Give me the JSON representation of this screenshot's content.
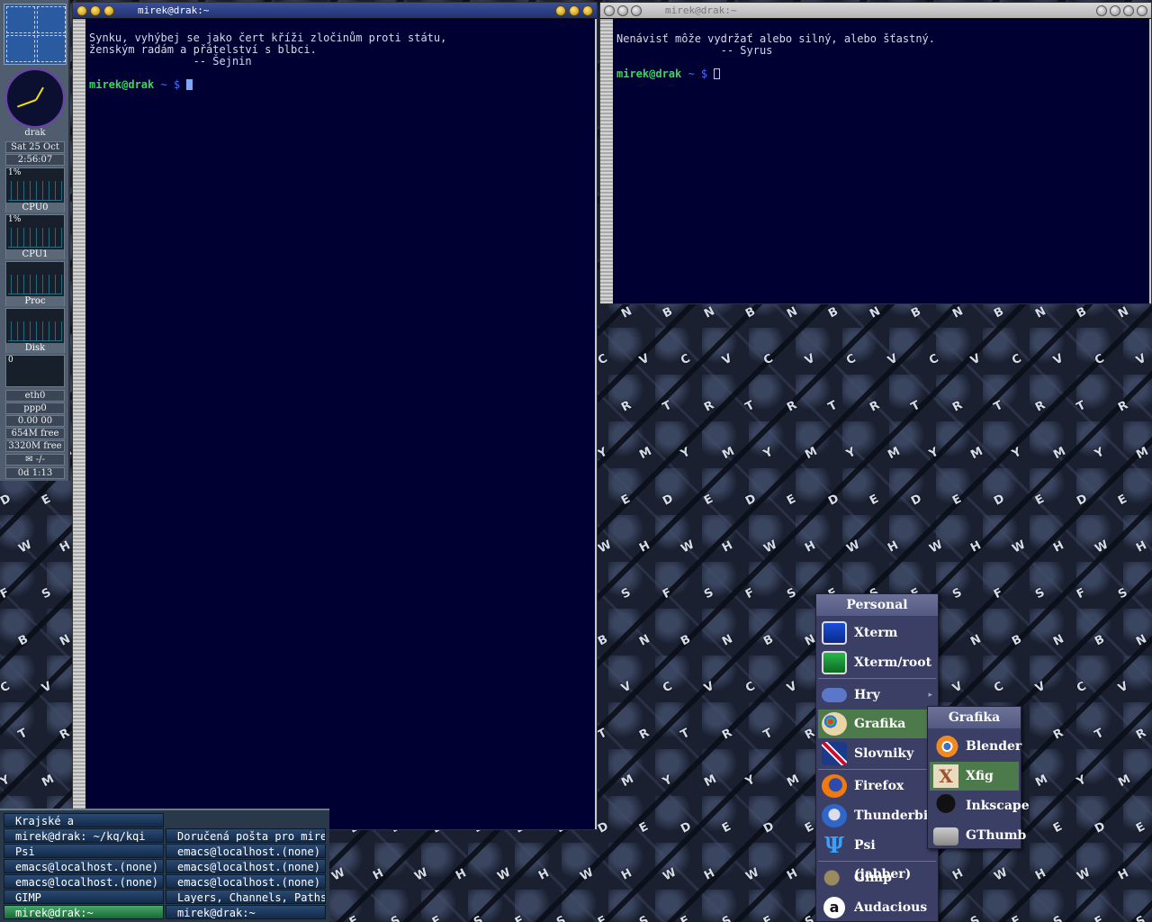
{
  "dock": {
    "host": "drak",
    "date": "Sat 25 Oct",
    "time": "2:56:07",
    "cpu0": {
      "pct": "1%",
      "label": "CPU0"
    },
    "cpu1": {
      "pct": "1%",
      "label": "CPU1"
    },
    "proc": {
      "label": "Proc"
    },
    "disk": {
      "pct": "0",
      "label": "Disk"
    },
    "net": [
      "eth0",
      "ppp0"
    ],
    "net_rate": "0.00 00",
    "mem_free": "654M free",
    "swap_free": "3320M free",
    "mail": "-/-",
    "uptime": "0d 1:13"
  },
  "windows": [
    {
      "title": "mirek@drak:~",
      "lines": [
        "Synku, vyhýbej se jako čert kříži zločinům proti státu,",
        "ženským radám a přátelství s blbci.",
        "                -- Šejnin"
      ],
      "prompt_user": "mirek@drak",
      "prompt_path": " ~ $ "
    },
    {
      "title": "mirek@drak:~",
      "lines": [
        "Nenávisť môže vydržať alebo silný, alebo šťastný.",
        "                -- Syrus"
      ],
      "prompt_user": "mirek@drak",
      "prompt_path": " ~ $ "
    }
  ],
  "taskbar": [
    [
      "Krajské a",
      ""
    ],
    [
      "mirek@drak: ~/kq/kqi",
      "Doručená pošta pro mire"
    ],
    [
      "Psi",
      "emacs@localhost.(none)"
    ],
    [
      "emacs@localhost.(none)",
      "emacs@localhost.(none)"
    ],
    [
      "emacs@localhost.(none)",
      "emacs@localhost.(none)"
    ],
    [
      "GIMP",
      "Layers, Channels, Paths"
    ],
    [
      "mirek@drak:~",
      "mirek@drak:~"
    ]
  ],
  "menu": {
    "title": "Personal",
    "items": [
      "Xterm",
      "Xterm/root",
      "Hry",
      "Grafika",
      "Slovniky",
      "Firefox",
      "Thunderbird",
      "Psi (jabber)",
      "Gimp",
      "Audacious"
    ],
    "icons": [
      "terminal-icon",
      "terminal-root-icon",
      "gamepad-icon",
      "palette-icon",
      "uk-flag-icon",
      "firefox-icon",
      "thunderbird-icon",
      "psi-icon",
      "gimp-icon",
      "audacious-icon"
    ]
  },
  "submenu": {
    "title": "Grafika",
    "items": [
      "Blender",
      "Xfig",
      "Inkscape",
      "GThumb"
    ],
    "icons": [
      "blender-icon",
      "xfig-icon",
      "inkscape-icon",
      "camera-icon"
    ]
  },
  "colors": {
    "terminal_bg": "#000033",
    "prompt_user": "#39d65a",
    "prompt_path": "#4a6cff",
    "menu_bg": "#3b3f66",
    "menu_highlight": "#4c7a4a"
  }
}
